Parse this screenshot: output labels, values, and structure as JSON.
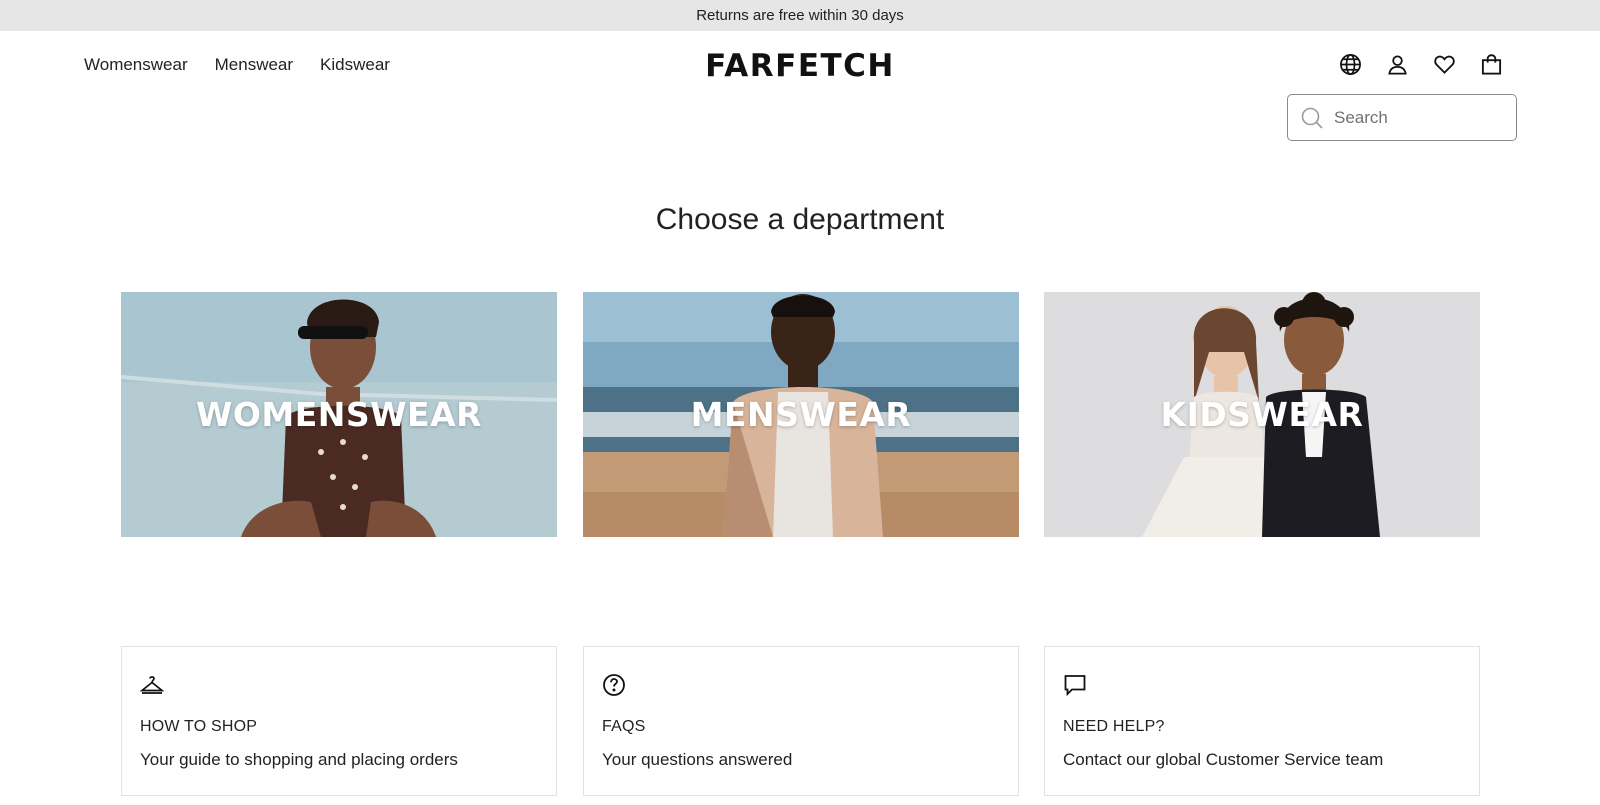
{
  "promo": {
    "text": "Returns are free within 30 days"
  },
  "nav": {
    "items": [
      "Womenswear",
      "Menswear",
      "Kidswear"
    ]
  },
  "logo": {
    "text": "FARFETCH"
  },
  "icons": [
    "globe-icon",
    "account-icon",
    "wishlist-icon",
    "bag-icon"
  ],
  "search": {
    "placeholder": "Search"
  },
  "heading": "Choose a department",
  "departments": [
    {
      "label": "WOMENSWEAR"
    },
    {
      "label": "MENSWEAR"
    },
    {
      "label": "KIDSWEAR"
    }
  ],
  "help_cards": [
    {
      "icon": "hanger-icon",
      "title": "HOW TO SHOP",
      "text": "Your guide to shopping and placing orders"
    },
    {
      "icon": "question-icon",
      "title": "FAQS",
      "text": "Your questions answered"
    },
    {
      "icon": "chat-icon",
      "title": "NEED HELP?",
      "text": "Contact our global Customer Service team"
    }
  ],
  "colors": {
    "promo_bg": "#e6e6e6",
    "text": "#222222",
    "border": "#e2e2e2"
  }
}
